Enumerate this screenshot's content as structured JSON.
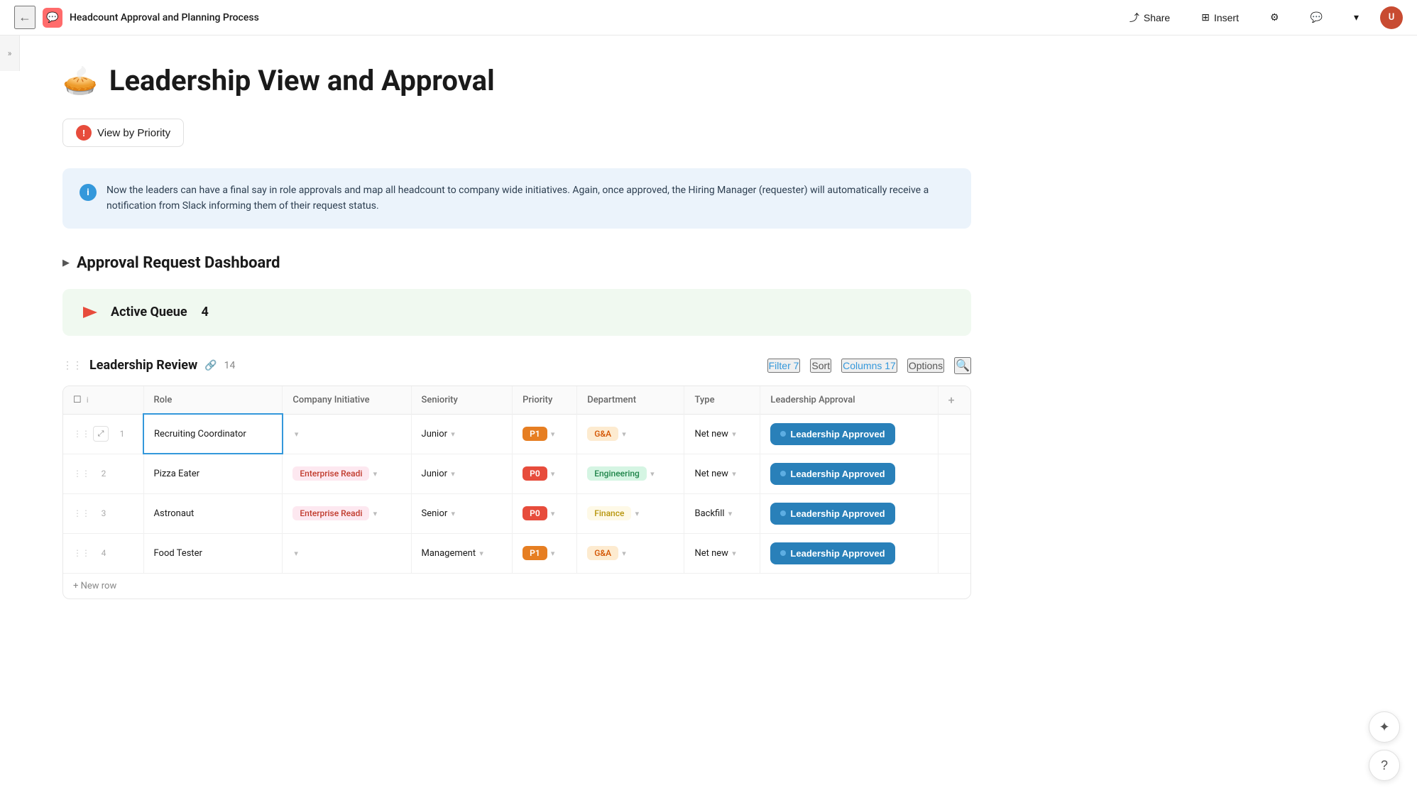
{
  "header": {
    "back_label": "←",
    "doc_icon": "💬",
    "doc_title": "Headcount Approval and Planning Process",
    "share_label": "Share",
    "insert_label": "Insert",
    "insert_icon": "⊞"
  },
  "page": {
    "emoji": "🥧",
    "title": "Leadership View and Approval"
  },
  "view_by_priority": {
    "label": "View by Priority"
  },
  "info_box": {
    "text": "Now the leaders can have a final say in role approvals and map all headcount to company wide initiatives. Again, once approved, the Hiring Manager (requester) will automatically receive a notification from Slack informing them of their request status."
  },
  "approval_dashboard": {
    "title": "Approval Request Dashboard",
    "toggle": "▶"
  },
  "active_queue": {
    "label": "Active Queue",
    "count": "4"
  },
  "leadership_review": {
    "title": "Leadership Review",
    "link_count": "14",
    "filter_label": "Filter",
    "filter_count": "7",
    "sort_label": "Sort",
    "columns_label": "Columns",
    "columns_count": "17",
    "options_label": "Options"
  },
  "table": {
    "columns": [
      "Role",
      "Company Initiative",
      "Seniority",
      "Priority",
      "Department",
      "Type",
      "Leadership Approval"
    ],
    "rows": [
      {
        "num": "1",
        "role": "Recruiting Coordinator",
        "company_initiative": "",
        "seniority": "Junior",
        "priority": "P1",
        "priority_class": "tag-p1",
        "department": "G&A",
        "department_class": "tag-ga",
        "type": "Net new",
        "approval": "Leadership Approved"
      },
      {
        "num": "2",
        "role": "Pizza Eater",
        "company_initiative": "Enterprise Readi",
        "company_initiative_class": "tag-enterprise",
        "seniority": "Junior",
        "priority": "P0",
        "priority_class": "tag-p0",
        "department": "Engineering",
        "department_class": "tag-engineering",
        "type": "Net new",
        "approval": "Leadership Approved"
      },
      {
        "num": "3",
        "role": "Astronaut",
        "company_initiative": "Enterprise Readi",
        "company_initiative_class": "tag-enterprise",
        "seniority": "Senior",
        "priority": "P0",
        "priority_class": "tag-p0",
        "department": "Finance",
        "department_class": "tag-finance",
        "type": "Backfill",
        "approval": "Leadership Approved"
      },
      {
        "num": "4",
        "role": "Food Tester",
        "company_initiative": "",
        "seniority": "Management",
        "priority": "P1",
        "priority_class": "tag-p1",
        "department": "G&A",
        "department_class": "tag-ga",
        "type": "Net new",
        "approval": "Leadership Approved"
      }
    ],
    "new_row_label": "+ New row"
  },
  "floating": {
    "sparkle_label": "✦",
    "help_label": "?"
  }
}
